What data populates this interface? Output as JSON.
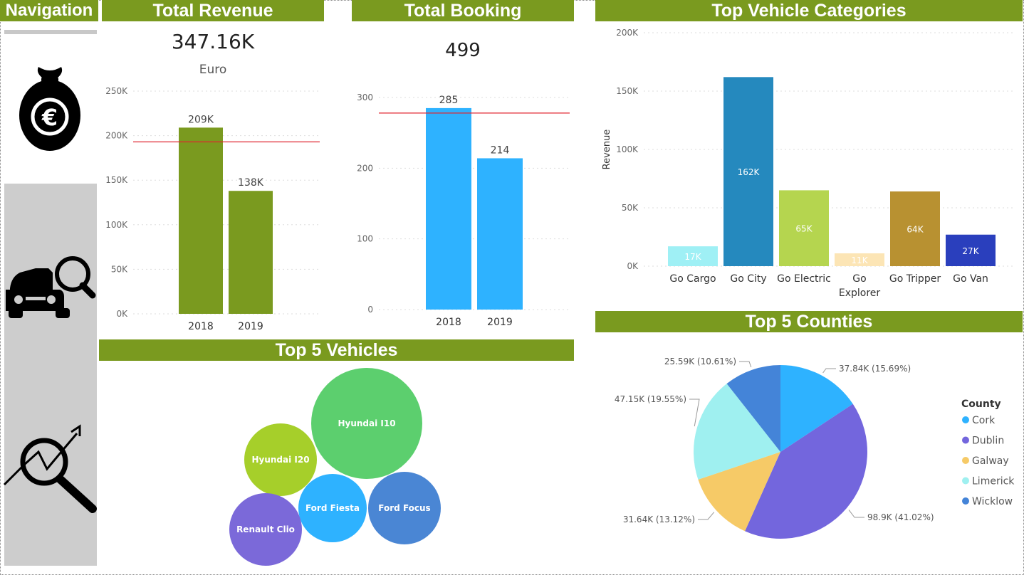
{
  "nav": {
    "title": "Navigation",
    "icons": [
      "money-bag-euro-icon",
      "car-search-icon",
      "analytics-search-icon"
    ]
  },
  "revenue": {
    "title": "Total Revenue",
    "kpi": "347.16K",
    "unit": "Euro"
  },
  "booking": {
    "title": "Total Booking",
    "kpi": "499"
  },
  "categories": {
    "title": "Top Vehicle Categories"
  },
  "vehicles": {
    "title": "Top 5 Vehicles"
  },
  "counties": {
    "title": "Top 5 Counties"
  },
  "colors": {
    "header": "#7a9a1f",
    "revenue_bar": "#7a9a1f",
    "booking_bar": "#2eb2ff",
    "reference_line": "#e0242f"
  },
  "chart_data": [
    {
      "id": "revenue",
      "type": "bar",
      "categories": [
        "2018",
        "2019"
      ],
      "values": [
        209000,
        138000
      ],
      "data_labels": [
        "209K",
        "138K"
      ],
      "yticks": [
        "0K",
        "50K",
        "100K",
        "150K",
        "200K",
        "250K"
      ],
      "ylim": [
        0,
        250000
      ],
      "reference_line": 193000,
      "grid": true
    },
    {
      "id": "booking",
      "type": "bar",
      "categories": [
        "2018",
        "2019"
      ],
      "values": [
        285,
        214
      ],
      "data_labels": [
        "285",
        "214"
      ],
      "yticks": [
        "0",
        "100",
        "200",
        "300"
      ],
      "ylim": [
        0,
        300
      ],
      "reference_line": 278,
      "grid": true
    },
    {
      "id": "categories",
      "type": "bar",
      "ylabel": "Revenue",
      "categories": [
        "Go Cargo",
        "Go City",
        "Go Electric",
        "Go Explorer",
        "Go Tripper",
        "Go Van"
      ],
      "category_lines": [
        [
          "Go Cargo"
        ],
        [
          "Go City"
        ],
        [
          "Go Electric"
        ],
        [
          "Go",
          "Explorer"
        ],
        [
          "Go Tripper"
        ],
        [
          "Go Van"
        ]
      ],
      "values": [
        17000,
        162000,
        65000,
        11000,
        64000,
        27000
      ],
      "data_labels": [
        "17K",
        "162K",
        "65K",
        "11K",
        "64K",
        "27K"
      ],
      "colors": [
        "#9ff0f5",
        "#2589be",
        "#b5d54f",
        "#fce5b5",
        "#b89131",
        "#2a3fbd"
      ],
      "yticks": [
        "0K",
        "50K",
        "100K",
        "150K",
        "200K"
      ],
      "ylim": [
        0,
        200000
      ],
      "grid": true
    },
    {
      "id": "vehicles",
      "type": "bubble",
      "items": [
        {
          "name": "Hyundai I10",
          "color": "#5ccf6e"
        },
        {
          "name": "Hyundai I20",
          "color": "#a6cf2a"
        },
        {
          "name": "Ford Fiesta",
          "color": "#2eb2ff"
        },
        {
          "name": "Ford Focus",
          "color": "#4a86d4"
        },
        {
          "name": "Renault Clio",
          "color": "#7b69d9"
        }
      ]
    },
    {
      "id": "counties",
      "type": "pie",
      "legend_title": "County",
      "legend_position": "right",
      "slices": [
        {
          "name": "Cork",
          "value": 37.84,
          "label": "37.84K (15.69%)",
          "color": "#2eb2ff"
        },
        {
          "name": "Dublin",
          "value": 98.9,
          "label": "98.9K (41.02%)",
          "color": "#7366dd"
        },
        {
          "name": "Galway",
          "value": 31.64,
          "label": "31.64K (13.12%)",
          "color": "#f6ca67"
        },
        {
          "name": "Limerick",
          "value": 47.15,
          "label": "47.15K (19.55%)",
          "color": "#9ff0f0"
        },
        {
          "name": "Wicklow",
          "value": 25.59,
          "label": "25.59K (10.61%)",
          "color": "#4484d8"
        }
      ]
    }
  ]
}
